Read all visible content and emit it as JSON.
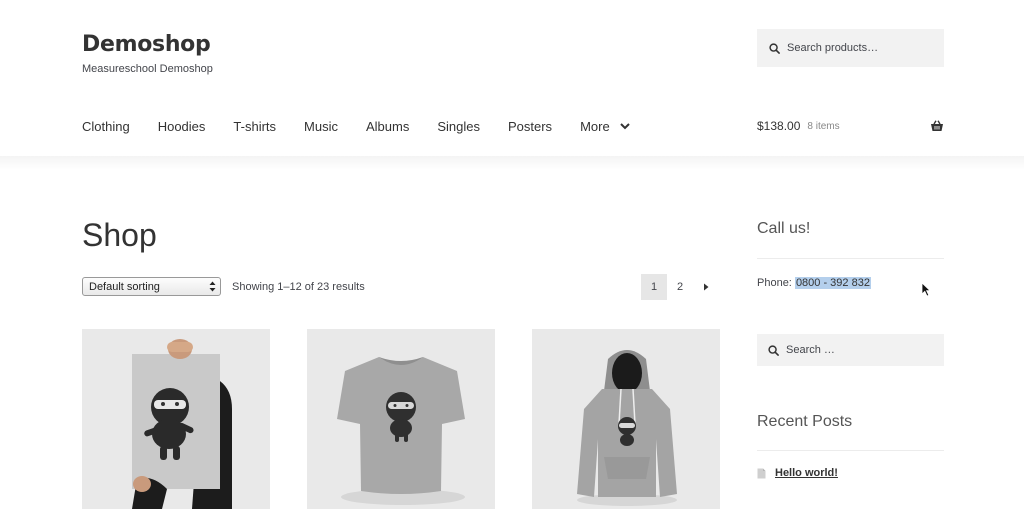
{
  "site": {
    "title": "Demoshop",
    "tagline": "Measureschool Demoshop"
  },
  "header_search": {
    "placeholder": "Search products…",
    "icon": "search-icon"
  },
  "nav": {
    "items": [
      "Clothing",
      "Hoodies",
      "T-shirts",
      "Music",
      "Albums",
      "Singles",
      "Posters"
    ],
    "more_label": "More",
    "more_icon": "chevron-down-icon"
  },
  "cart": {
    "amount": "$138.00",
    "count": "8 items",
    "icon": "basket-icon"
  },
  "shop": {
    "title": "Shop",
    "sort_selected": "Default sorting",
    "result_count": "Showing 1–12 of 23 results",
    "pagination": {
      "current": "1",
      "next_page": "2",
      "next_icon": "chevron-right-icon"
    },
    "products": [
      {
        "depicts": "ninja poster held up by a person",
        "icon": "poster-image"
      },
      {
        "depicts": "grey ninja t-shirt",
        "icon": "tshirt-image"
      },
      {
        "depicts": "grey ninja hoodie",
        "icon": "hoodie-image"
      }
    ]
  },
  "sidebar": {
    "call_title": "Call us!",
    "phone_label": "Phone:",
    "phone_number": "0800 - 392 832",
    "search_placeholder": "Search …",
    "recent_title": "Recent Posts",
    "recent_posts": [
      "Hello world!"
    ],
    "post_icon": "document-icon"
  },
  "colors": {
    "text": "#43454b",
    "heading": "#333333",
    "search_bg": "#f2f2f2",
    "product_bg": "#e9e9e9",
    "selection_highlight": "#b4cfec",
    "current_page_bg": "#e6e6e6"
  }
}
